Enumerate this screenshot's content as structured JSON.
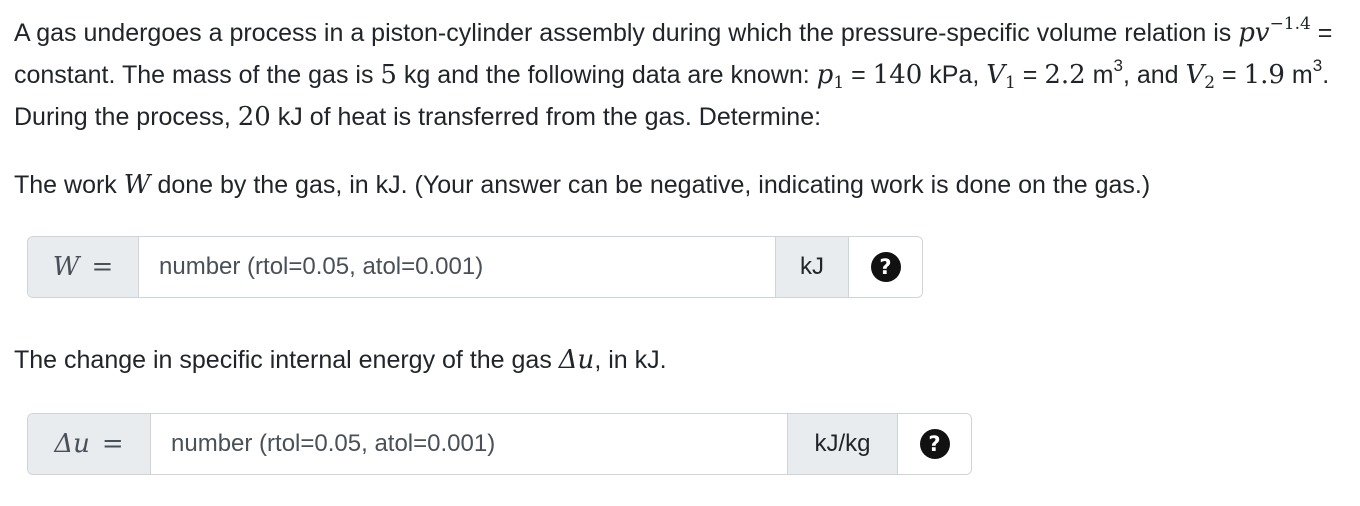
{
  "problem": {
    "s1": "A gas undergoes a process in a piston-cylinder assembly during which the pressure-specific volume relation is ",
    "eq_lhs": "pv",
    "eq_exp": "−1.4",
    "s2": " = constant. The mass of the gas is ",
    "mass": "5",
    "s3": " kg and the following data are known: ",
    "p_sym": "p",
    "p_sub": "1",
    "s4": " = ",
    "p_val": "140",
    "s5": " kPa, ",
    "v1_sym": "V",
    "v1_sub": "1",
    "s6": " = ",
    "v1_val": "2.2",
    "s7": " m",
    "v1_exp": "3",
    "s8": ", and ",
    "v2_sym": "V",
    "v2_sub": "2",
    "s9": " = ",
    "v2_val": "1.9",
    "s10": " m",
    "v2_exp": "3",
    "s11": ". During the process, ",
    "heat": "20",
    "s12": " kJ of heat is transferred from the gas. Determine:"
  },
  "question1": {
    "t1": "The work ",
    "sym": "W",
    "t2": " done by the gas, in kJ. (Your answer can be negative, indicating work is done on the gas.)",
    "label_sym": "W",
    "label_eq": "=",
    "placeholder": "number (rtol=0.05, atol=0.001)",
    "value": "",
    "unit": "kJ",
    "help_glyph": "?"
  },
  "question2": {
    "t1": "The change in specific internal energy of the gas ",
    "sym": "Δu",
    "t2": ", in kJ.",
    "label_sym": "Δu",
    "label_eq": "=",
    "placeholder": "number (rtol=0.05, atol=0.001)",
    "value": "",
    "unit": "kJ/kg",
    "help_glyph": "?"
  },
  "icons": {
    "help": "question-circle-icon"
  }
}
